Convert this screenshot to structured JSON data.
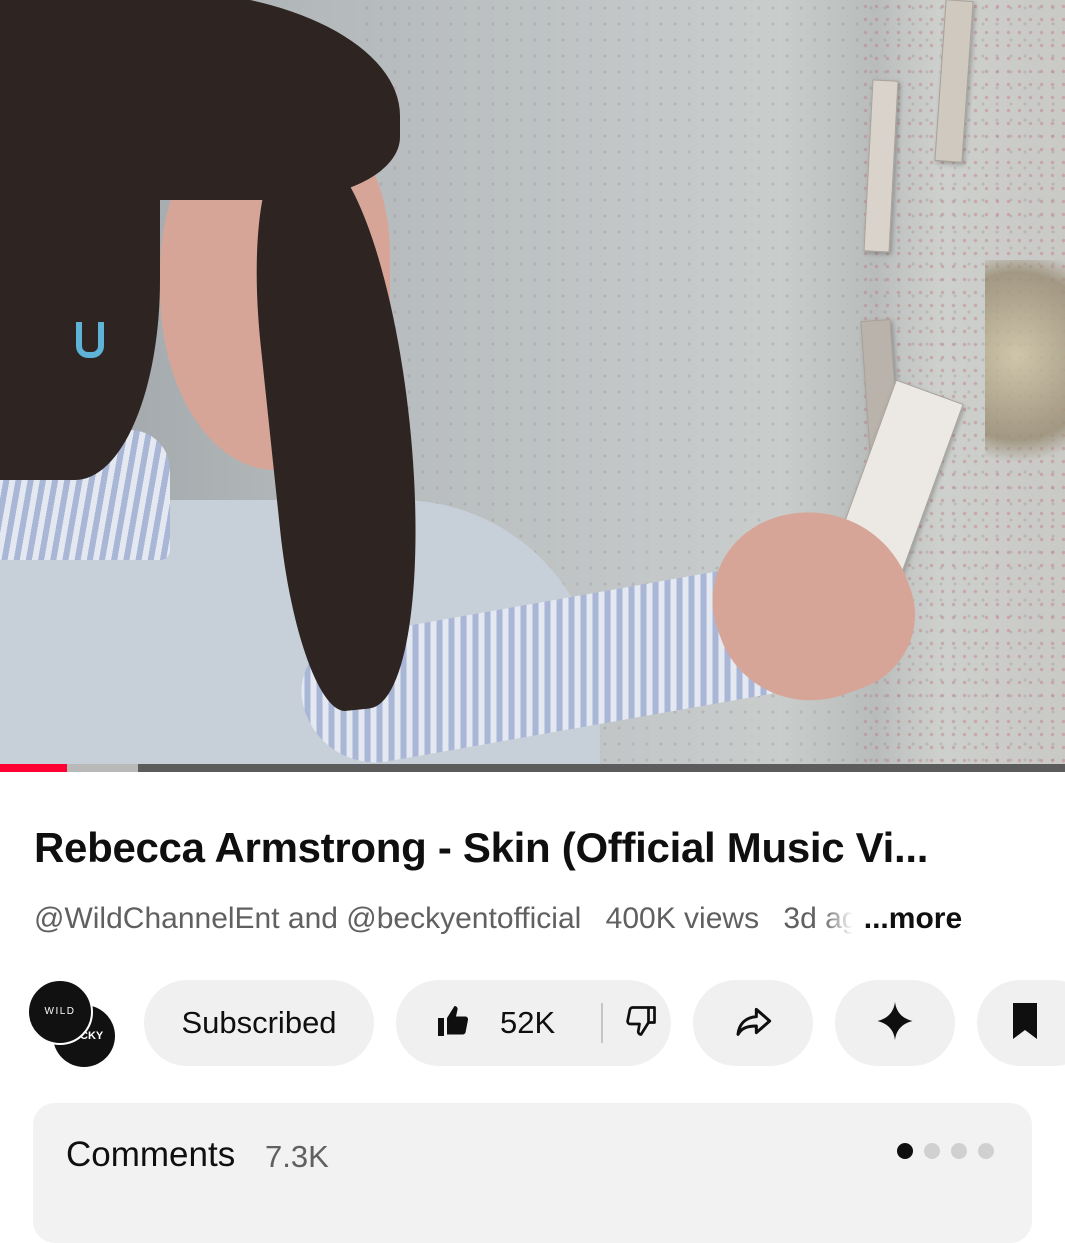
{
  "video": {
    "progress_played": 0.063,
    "progress_buffered": 0.13,
    "colors": {
      "played": "#ff0033",
      "buffered": "#b9b9b9",
      "track": "#5c5c5c"
    }
  },
  "info": {
    "title": "Rebecca Armstrong - Skin (Official Music Vi...",
    "channels": "@WildChannelEnt and @beckyentofficial",
    "views": "400K views",
    "age": "3d ago",
    "more": "...more"
  },
  "actions": {
    "avatar_primary": "WILD",
    "avatar_secondary": "BECKY",
    "subscribe_label": "Subscribed",
    "like_count": "52K",
    "icons": [
      "thumbs-up-icon",
      "thumbs-down-icon",
      "share-icon",
      "sparkle-icon",
      "bookmark-icon"
    ]
  },
  "comments": {
    "label": "Comments",
    "count": "7.3K",
    "page_dots": 4,
    "active_dot": 0
  }
}
